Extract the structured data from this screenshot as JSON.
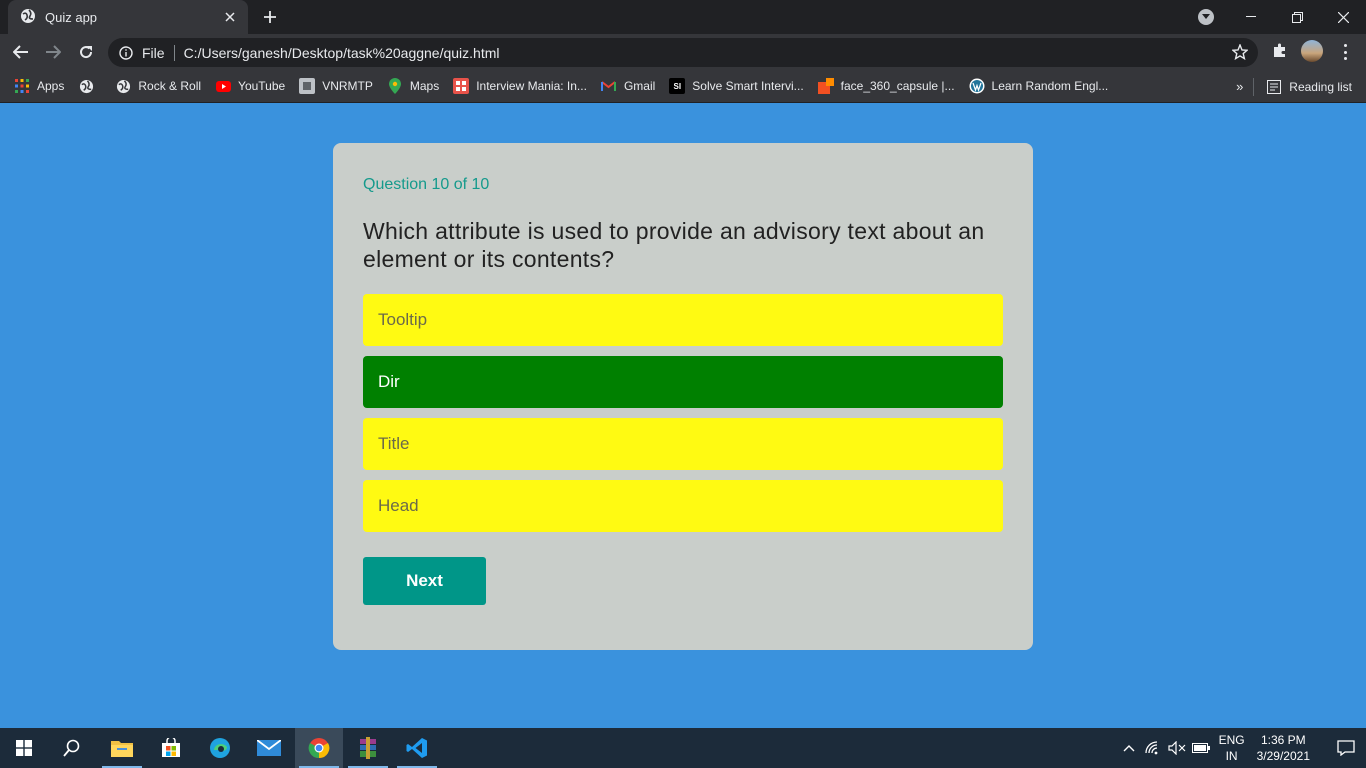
{
  "browser": {
    "tab_title": "Quiz app",
    "address_prefix": "File",
    "url": "C:/Users/ganesh/Desktop/task%20aggne/quiz.html"
  },
  "bookmarks": {
    "items": [
      {
        "label": "Apps",
        "icon": "apps-grid-icon",
        "color": "#ea4335"
      },
      {
        "label": "",
        "icon": "globe-icon",
        "color": "#e8eaed"
      },
      {
        "label": "Rock & Roll",
        "icon": "globe-icon",
        "color": "#e8eaed"
      },
      {
        "label": "YouTube",
        "icon": "youtube-icon",
        "color": "#ff0000"
      },
      {
        "label": "VNRMTP",
        "icon": "vnrmtp-icon",
        "color": "#9aa0a6"
      },
      {
        "label": "Maps",
        "icon": "maps-pin-icon",
        "color": "#34a853"
      },
      {
        "label": "Interview Mania: In...",
        "icon": "interview-mania-icon",
        "color": "#e8534a"
      },
      {
        "label": "Gmail",
        "icon": "gmail-icon",
        "color": "#ea4335"
      },
      {
        "label": "Solve Smart Intervi...",
        "icon": "smart-interviews-icon",
        "color": "#000000"
      },
      {
        "label": "face_360_capsule |...",
        "icon": "capsule-icon",
        "color": "#f25022"
      },
      {
        "label": "Learn Random Engl...",
        "icon": "wordpress-icon",
        "color": "#21759b"
      }
    ],
    "overflow": "»",
    "reading_list": "Reading list"
  },
  "quiz": {
    "counter": "Question 10 of 10",
    "question": "Which attribute is used to provide an advisory text about an element or its contents?",
    "answers": [
      {
        "text": "Tooltip",
        "state": "default"
      },
      {
        "text": "Dir",
        "state": "correct"
      },
      {
        "text": "Title",
        "state": "default"
      },
      {
        "text": "Head",
        "state": "default"
      }
    ],
    "next_label": "Next",
    "colors": {
      "answer": "#fffa12",
      "correct": "#008000",
      "next": "#009688",
      "card": "#c9ceca",
      "page": "#3a92dd"
    }
  },
  "taskbar": {
    "apps": [
      "start-icon",
      "search-icon",
      "file-explorer-icon",
      "store-icon",
      "edge-icon",
      "mail-icon",
      "chrome-icon",
      "winrar-icon",
      "vscode-icon"
    ],
    "lang_line1": "ENG",
    "lang_line2": "IN",
    "time": "1:36 PM",
    "date": "3/29/2021"
  }
}
